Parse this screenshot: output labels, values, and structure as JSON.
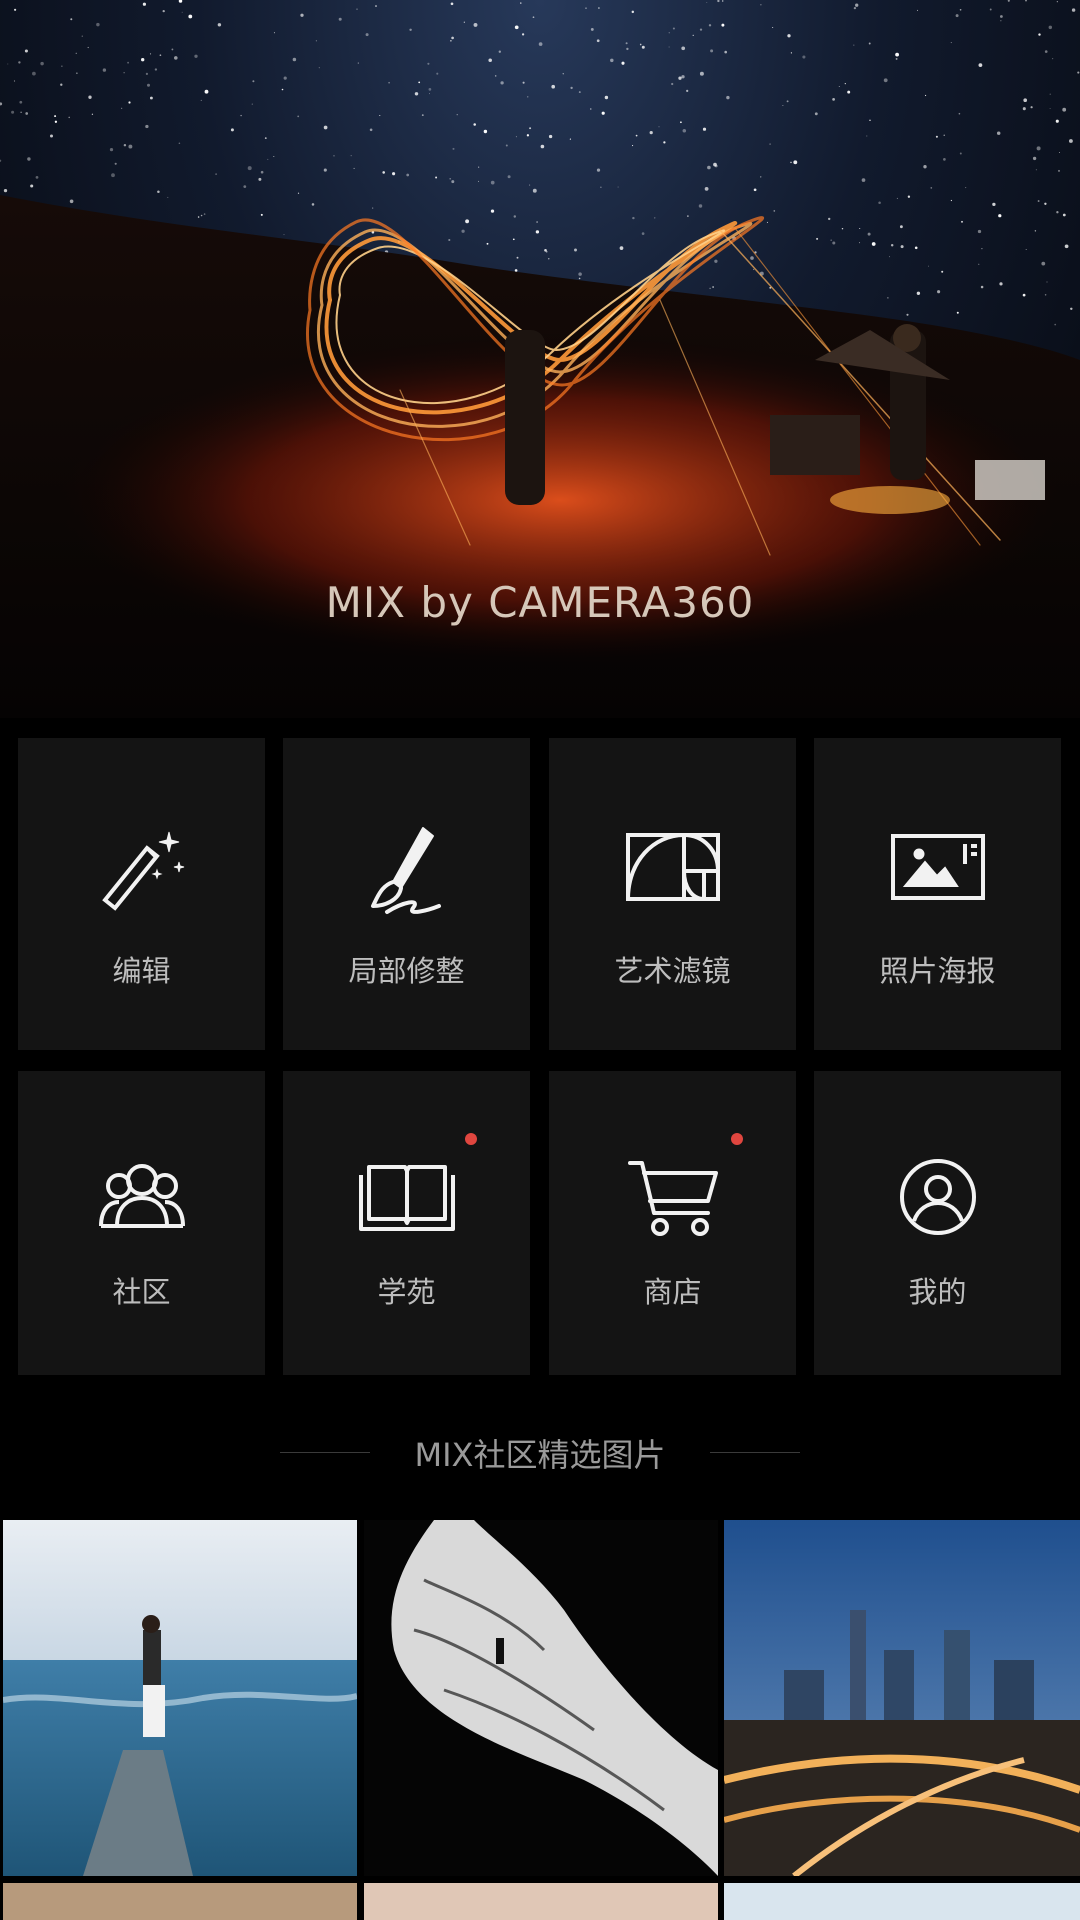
{
  "hero": {
    "brand": "MIX by CAMERA360"
  },
  "features": [
    {
      "label": "编辑",
      "icon": "magic-wand-icon",
      "badge": false
    },
    {
      "label": "局部修整",
      "icon": "brush-icon",
      "badge": false
    },
    {
      "label": "艺术滤镜",
      "icon": "golden-ratio-icon",
      "badge": false
    },
    {
      "label": "照片海报",
      "icon": "photo-poster-icon",
      "badge": false
    },
    {
      "label": "社区",
      "icon": "community-icon",
      "badge": false
    },
    {
      "label": "学苑",
      "icon": "book-icon",
      "badge": true
    },
    {
      "label": "商店",
      "icon": "cart-icon",
      "badge": true
    },
    {
      "label": "我的",
      "icon": "profile-icon",
      "badge": false
    }
  ],
  "section": {
    "title": "MIX社区精选图片"
  },
  "colors": {
    "background": "#000000",
    "tile": "#141414",
    "badge": "#e0463f"
  }
}
